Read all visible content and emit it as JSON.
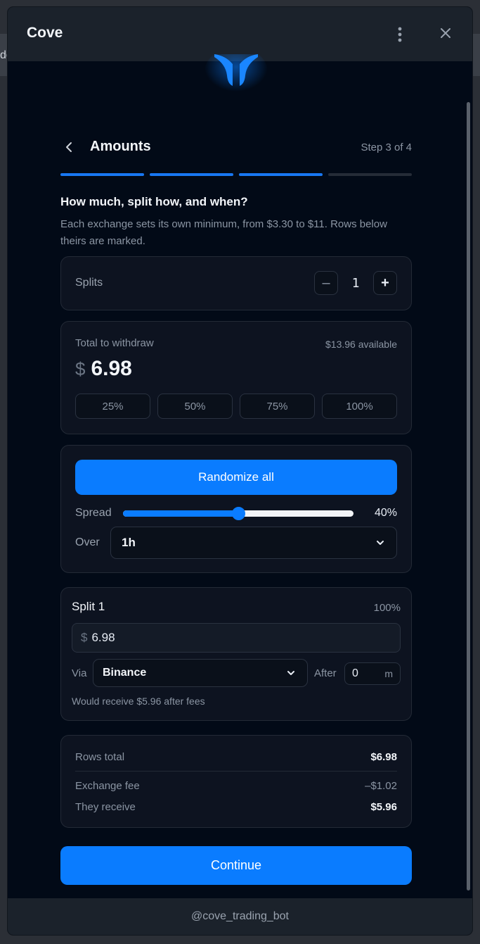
{
  "window": {
    "title": "Cove",
    "footer_handle": "@cove_trading_bot"
  },
  "header": {
    "title": "Amounts",
    "step": "Step 3 of 4",
    "progress": {
      "total_steps": 4,
      "current_step": 3
    }
  },
  "intro": {
    "question": "How much, split how, and when?",
    "hint": "Each exchange sets its own minimum, from $3.30 to $11. Rows below theirs are marked."
  },
  "splits": {
    "label": "Splits",
    "value": "1",
    "minus": "–",
    "plus": "+"
  },
  "total": {
    "label": "Total to withdraw",
    "available": "$13.96 available",
    "currency": "$",
    "amount": "6.98",
    "percent_buttons": [
      "25%",
      "50%",
      "75%",
      "100%"
    ]
  },
  "randomize": {
    "button": "Randomize all",
    "spread_label": "Spread",
    "spread_value": "40%",
    "spread_level": 0.5,
    "over_label": "Over",
    "over_value": "1h"
  },
  "split_rows": [
    {
      "title": "Split 1",
      "percent": "100%",
      "currency": "$",
      "amount": "6.98",
      "via_label": "Via",
      "exchange": "Binance",
      "after_label": "After",
      "after_value": "0",
      "after_unit": "m",
      "note": "Would receive $5.96 after fees"
    }
  ],
  "summary": {
    "rows_total_label": "Rows total",
    "rows_total": "$6.98",
    "fee_label": "Exchange fee",
    "fee": "–$1.02",
    "receive_label": "They receive",
    "receive": "$5.96"
  },
  "actions": {
    "continue": "Continue"
  },
  "colors": {
    "accent": "#0a7cff",
    "background": "#020a17",
    "card": "#0d1320",
    "titlebar": "#1b222b"
  },
  "icons": [
    "app-logo-icon",
    "more-vertical-icon",
    "close-icon",
    "chevron-left-icon",
    "chevron-down-icon"
  ]
}
